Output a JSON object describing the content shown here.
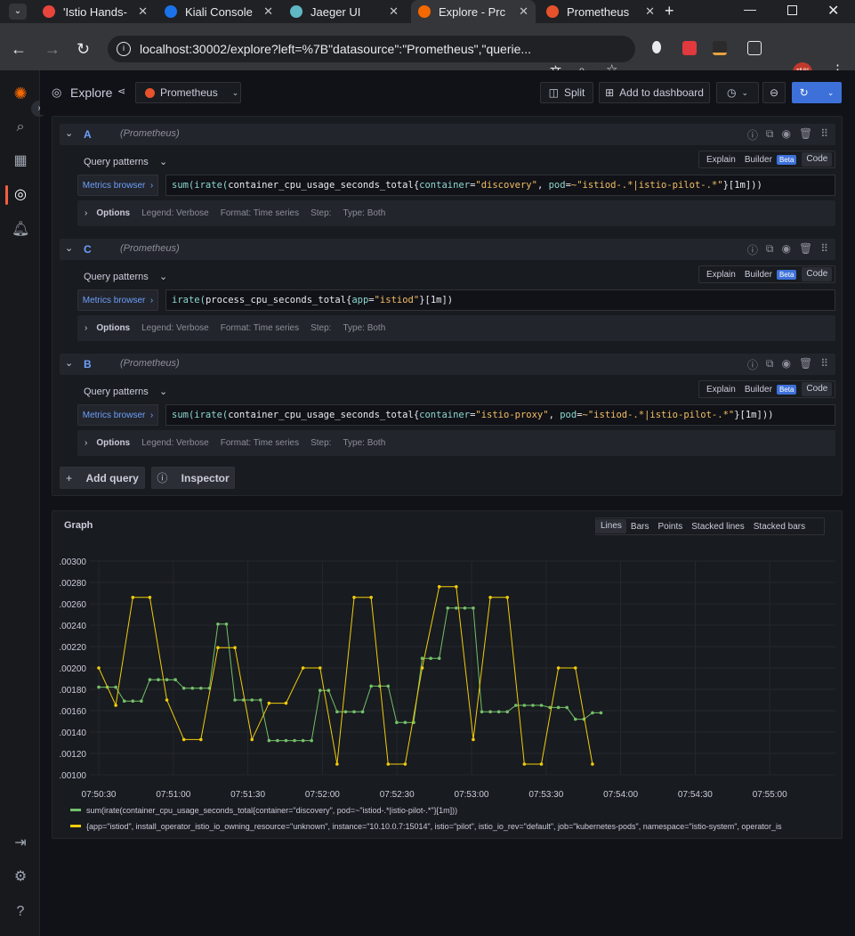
{
  "browser": {
    "tabs": [
      {
        "label": "'Istio Hands-",
        "color": "#e8453c"
      },
      {
        "label": "Kiali Console",
        "color": "#1a73e8"
      },
      {
        "label": "Jaeger UI",
        "color": "#5fb8c4"
      },
      {
        "label": "Explore - Prc",
        "color": "#f46800"
      },
      {
        "label": "Prometheus",
        "color": "#e6522c"
      }
    ],
    "url": "localhost:30002/explore?left=%7B\"datasource\":\"Prometheus\",\"querie...",
    "profile": "제원"
  },
  "header": {
    "title": "Explore",
    "datasource": "Prometheus",
    "split_label": "Split",
    "add_dashboard_label": "Add to dashboard"
  },
  "queries": [
    {
      "ref": "A",
      "datasource": "(Prometheus)",
      "patterns": "Query patterns",
      "explain": "Explain",
      "builder": "Builder",
      "beta": "Beta",
      "code": "Code",
      "metrics_browser": "Metrics browser",
      "expr_fn": "sum(irate(",
      "expr_metric": "container_cpu_usage_seconds_total{",
      "expr_labels": [
        {
          "k": "container",
          "v": "\"discovery\""
        },
        {
          "k": "pod",
          "v": "~\"istiod-.*|istio-pilot-.*\""
        }
      ],
      "expr_tail": "}[1m]))",
      "options": "Options",
      "legend": "Legend: Verbose",
      "format": "Format: Time series",
      "step": "Step:",
      "type": "Type: Both"
    },
    {
      "ref": "C",
      "datasource": "(Prometheus)",
      "patterns": "Query patterns",
      "explain": "Explain",
      "builder": "Builder",
      "beta": "Beta",
      "code": "Code",
      "metrics_browser": "Metrics browser",
      "expr_fn": "irate(",
      "expr_metric": "process_cpu_seconds_total{",
      "expr_labels": [
        {
          "k": "app",
          "v": "\"istiod\""
        }
      ],
      "expr_tail": "}[1m])",
      "options": "Options",
      "legend": "Legend: Verbose",
      "format": "Format: Time series",
      "step": "Step:",
      "type": "Type: Both"
    },
    {
      "ref": "B",
      "datasource": "(Prometheus)",
      "patterns": "Query patterns",
      "explain": "Explain",
      "builder": "Builder",
      "beta": "Beta",
      "code": "Code",
      "metrics_browser": "Metrics browser",
      "expr_fn": "sum(irate(",
      "expr_metric": "container_cpu_usage_seconds_total{",
      "expr_labels": [
        {
          "k": "container",
          "v": "\"istio-proxy\""
        },
        {
          "k": "pod",
          "v": "~\"istiod-.*|istio-pilot-.*\""
        }
      ],
      "expr_tail": "}[1m]))",
      "options": "Options",
      "legend": "Legend: Verbose",
      "format": "Format: Time series",
      "step": "Step:",
      "type": "Type: Both"
    }
  ],
  "actions": {
    "add_query": "Add query",
    "inspector": "Inspector"
  },
  "graph": {
    "title": "Graph",
    "vis_options": [
      "Lines",
      "Bars",
      "Points",
      "Stacked lines",
      "Stacked bars"
    ],
    "vis_selected": "Lines"
  },
  "chart_data": {
    "type": "line",
    "ylim": [
      0.001,
      0.003
    ],
    "yticks": [
      ".00300",
      ".00280",
      ".00260",
      ".00240",
      ".00220",
      ".00200",
      ".00180",
      ".00160",
      ".00140",
      ".00120",
      ".00100"
    ],
    "xticks": [
      "07:50:30",
      "07:51:00",
      "07:51:30",
      "07:52:00",
      "07:52:30",
      "07:53:00",
      "07:53:30",
      "07:54:00",
      "07:54:30",
      "07:55:00"
    ],
    "x_start_seconds": 0,
    "x": [
      0,
      5,
      10,
      15,
      20,
      25,
      30,
      35,
      40,
      45,
      50,
      55,
      60,
      65,
      70,
      75,
      80,
      85,
      90,
      95,
      100,
      105,
      110,
      115,
      120,
      125,
      130,
      135,
      140,
      145,
      150,
      155,
      160,
      165,
      170,
      175,
      180,
      185,
      190,
      195,
      200,
      205,
      210,
      215,
      220,
      225,
      230,
      235,
      240,
      245,
      250,
      255,
      260,
      265,
      270,
      275,
      280,
      285,
      290,
      295,
      300,
      305,
      310,
      315,
      320,
      325,
      330
    ],
    "series": [
      {
        "name": "sum(irate(container_cpu_usage_seconds_total{container=\"discovery\", pod=~\"istiod-.*|istio-pilot-.*\"}[1m]))",
        "color": "#73bf69",
        "values": [
          0.00182,
          0.00182,
          0.00182,
          0.00169,
          0.00169,
          0.00169,
          0.00189,
          0.00189,
          0.00189,
          0.00189,
          0.00181,
          0.00181,
          0.00181,
          0.00181,
          0.00241,
          0.00241,
          0.0017,
          0.0017,
          0.0017,
          0.0017,
          0.00132,
          0.00132,
          0.00132,
          0.00132,
          0.00132,
          0.00132,
          0.00179,
          0.00179,
          0.00159,
          0.00159,
          0.00159,
          0.00159,
          0.00183,
          0.00183,
          0.00183,
          0.00149,
          0.00149,
          0.00149,
          0.00209,
          0.00209,
          0.00209,
          0.00256,
          0.00256,
          0.00256,
          0.00256,
          0.00159,
          0.00159,
          0.00159,
          0.00159,
          0.00165,
          0.00165,
          0.00165,
          0.00165,
          0.00163,
          0.00163,
          0.00163,
          0.00152,
          0.00152,
          0.00158,
          0.00158
        ]
      },
      {
        "name": "{app=\"istiod\", install_operator_istio_io_owning_resource=\"unknown\", instance=\"10.10.0.7:15014\", istio=\"pilot\", istio_io_rev=\"default\", job=\"kubernetes-pods\", namespace=\"istio-system\", operator_is",
        "color": "#f2cc0c",
        "values": [
          0.002,
          0.00165,
          0.00266,
          0.00266,
          0.0017,
          0.00133,
          0.00133,
          0.00219,
          0.00219,
          0.00133,
          0.00167,
          0.00167,
          0.002,
          0.002,
          0.0011,
          0.00266,
          0.00266,
          0.0011,
          0.0011,
          0.002,
          0.00276,
          0.00276,
          0.00133,
          0.00266,
          0.00266,
          0.0011,
          0.0011,
          0.002,
          0.002,
          0.0011
        ]
      }
    ]
  }
}
